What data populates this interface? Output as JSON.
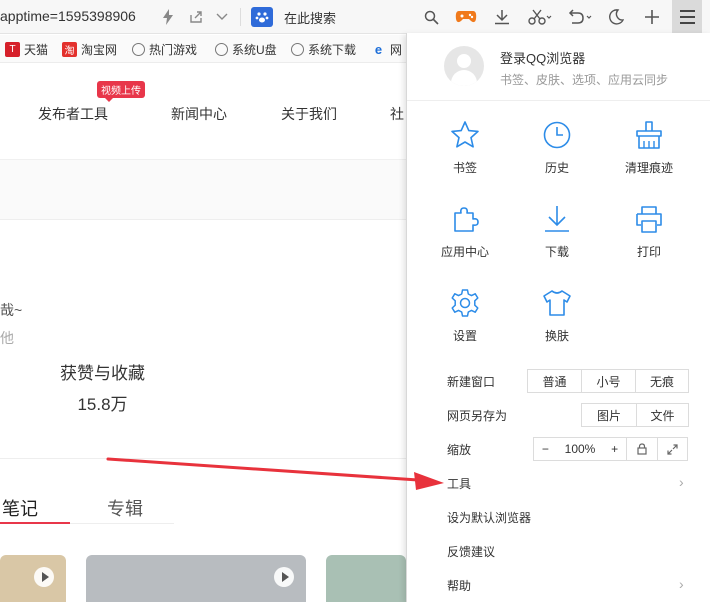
{
  "toolbar": {
    "url": "apptime=1595398906",
    "search_text": "在此搜索"
  },
  "bookmarks": [
    {
      "label": "天猫",
      "icon": "tmall-icon",
      "glyph": "T"
    },
    {
      "label": "淘宝网",
      "icon": "taobao-icon",
      "glyph": "淘"
    },
    {
      "label": "热门游戏",
      "icon": "globe-icon",
      "glyph": ""
    },
    {
      "label": "系统U盘",
      "icon": "globe-icon",
      "glyph": ""
    },
    {
      "label": "系统下载",
      "icon": "globe-icon",
      "glyph": ""
    },
    {
      "label": "网",
      "icon": "ie-icon",
      "glyph": "e"
    }
  ],
  "page": {
    "nav": [
      "发布者工具",
      "新闻中心",
      "关于我们",
      "社"
    ],
    "video_badge": "视频上传",
    "partial_line_1": "哉~",
    "partial_line_2": "他",
    "likes_label": "获赞与收藏",
    "likes_value": "15.8万",
    "tabs": [
      "笔记",
      "专辑"
    ]
  },
  "menu": {
    "login_title": "登录QQ浏览器",
    "login_sub": "书签、皮肤、选项、应用云同步",
    "grid": [
      {
        "label": "书签",
        "icon": "star-icon"
      },
      {
        "label": "历史",
        "icon": "clock-icon"
      },
      {
        "label": "清理痕迹",
        "icon": "broom-icon"
      },
      {
        "label": "应用中心",
        "icon": "puzzle-icon"
      },
      {
        "label": "下载",
        "icon": "download-icon"
      },
      {
        "label": "打印",
        "icon": "printer-icon"
      },
      {
        "label": "设置",
        "icon": "gear-icon"
      },
      {
        "label": "换肤",
        "icon": "tshirt-icon"
      }
    ],
    "new_window": {
      "label": "新建窗口",
      "options": [
        "普通",
        "小号",
        "无痕"
      ]
    },
    "save_as": {
      "label": "网页另存为",
      "options": [
        "图片",
        "文件"
      ]
    },
    "zoom": {
      "label": "缩放",
      "minus": "−",
      "value": "100%",
      "plus": "+"
    },
    "tools": "工具",
    "set_default": "设为默认浏览器",
    "feedback": "反馈建议",
    "help": "帮助"
  },
  "colors": {
    "accent_blue": "#2d8ce8",
    "badge_red": "#e8364a",
    "arrow_red": "#e8323c"
  }
}
